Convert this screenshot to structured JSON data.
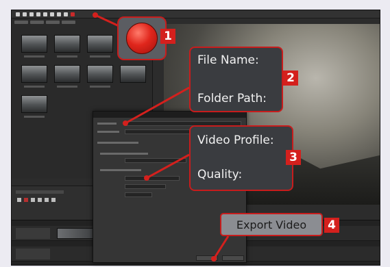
{
  "callouts": [
    {
      "number": "1",
      "target": "record-button"
    },
    {
      "number": "2",
      "lines": [
        "File Name:",
        "Folder Path:"
      ]
    },
    {
      "number": "3",
      "lines": [
        "Video Profile:",
        "Quality:"
      ]
    },
    {
      "number": "4",
      "button_label": "Export Video"
    }
  ],
  "icons": {
    "record": "record-icon"
  },
  "colors": {
    "accent_red": "#d4201d",
    "callout_bg": "#3a3c40",
    "app_bg": "#2c2c2c",
    "page_bg": "#ecebf2"
  }
}
